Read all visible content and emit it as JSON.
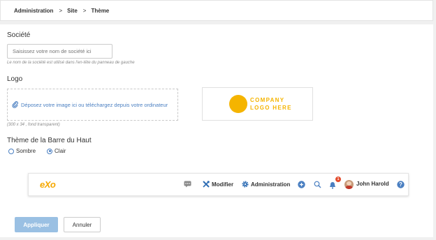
{
  "breadcrumb": {
    "items": [
      "Administration",
      "Site",
      "Thème"
    ],
    "separator": ">"
  },
  "company": {
    "label": "Société",
    "placeholder": "Saisissez votre nom de société ici",
    "help": "Le nom de la société est utilisé dans l'en-tête du panneau de gauche"
  },
  "logo": {
    "label": "Logo",
    "dropzone_text": "Déposez votre image ici ou téléchargez depuis votre ordinateur",
    "help": "(300 x 34 , fond transparent)",
    "preview_line1": "COMPANY",
    "preview_line2": "LOGO HERE",
    "preview_color": "#f5b400"
  },
  "topbar_theme": {
    "label": "Thème de la Barre du Haut",
    "options": [
      "Sombre",
      "Clair"
    ],
    "selected": "Clair"
  },
  "preview_bar": {
    "brand": "eXo",
    "modify_label": "Modifier",
    "admin_label": "Administration",
    "notification_count": "1",
    "user_name": "John Harold",
    "icons": [
      "chat-icon",
      "tools-icon",
      "gear-icon",
      "plus-icon",
      "search-icon",
      "bell-icon",
      "avatar",
      "help-icon"
    ]
  },
  "actions": {
    "apply_label": "Appliquer",
    "cancel_label": "Annuler"
  },
  "colors": {
    "accent": "#4a7fc1",
    "brand": "#f5a800",
    "apply_button": "#9ac0e3",
    "badge": "#e34a2b"
  }
}
